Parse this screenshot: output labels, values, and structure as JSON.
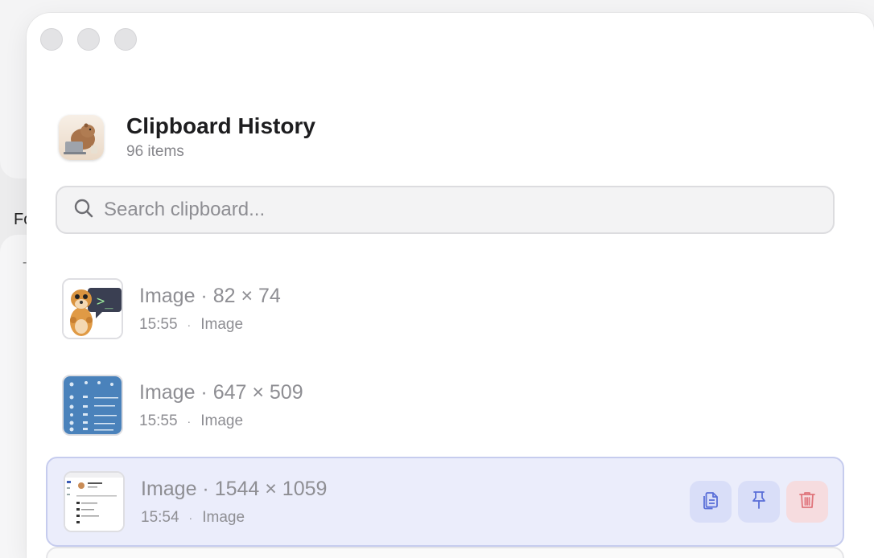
{
  "background": {
    "fragment_text": "Fo",
    "dash_text": "-"
  },
  "header": {
    "title": "Clipboard History",
    "item_count": "96 items",
    "icon": "capybara-laptop-app-icon"
  },
  "search": {
    "placeholder": "Search clipboard...",
    "value": ""
  },
  "items": [
    {
      "name": "Image · 82 × 74",
      "time": "15:55",
      "separator": "·",
      "kind": "Image",
      "thumb": "meerkat-terminal-image"
    },
    {
      "name": "Image · 647 × 509",
      "time": "15:55",
      "separator": "·",
      "kind": "Image",
      "thumb": "blue-screenshot-image"
    },
    {
      "name": "Image · 1544 × 1059",
      "time": "15:54",
      "separator": "·",
      "kind": "Image",
      "thumb": "white-screenshot-image",
      "selected": true
    }
  ],
  "actions": {
    "copy_icon": "copy-icon",
    "pin_icon": "pin-icon",
    "delete_icon": "trash-icon"
  },
  "colors": {
    "accent": "#5a6fd8",
    "delete": "#e0747b",
    "selected_bg": "#ebedfb"
  }
}
